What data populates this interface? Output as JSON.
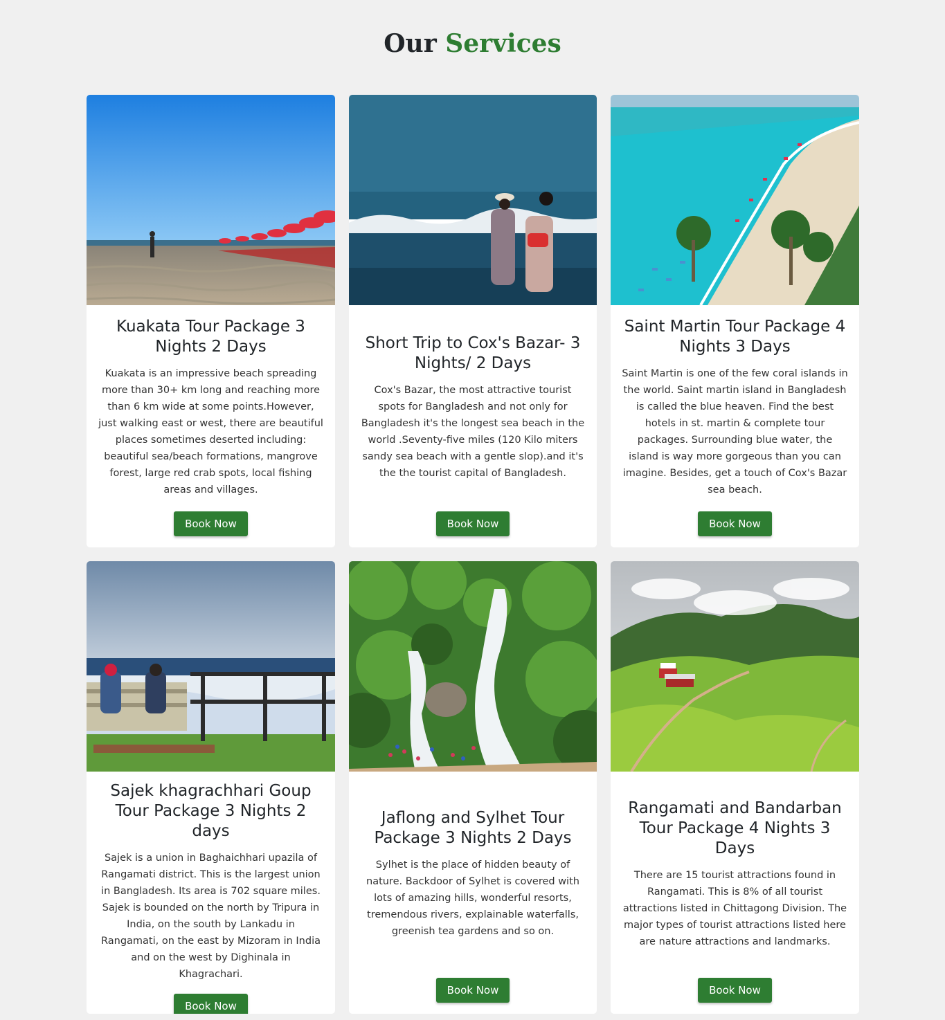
{
  "header": {
    "title_part1": "Our",
    "title_part2": "Services"
  },
  "colors": {
    "accent": "#2e7d32",
    "background": "#f0f0f0"
  },
  "services": [
    {
      "image_alt": "Kuakata beach with red umbrellas",
      "title": "Kuakata Tour Package 3 Nights 2 Days",
      "description": "Kuakata is an impressive beach spreading more than 30+ km long and reaching more than 6 km wide at some points.However, just walking east or west, there are beautiful places sometimes deserted including: beautiful sea/beach formations, mangrove forest, large red crab spots, local fishing areas and villages.",
      "button": "Book Now"
    },
    {
      "image_alt": "Two women at Cox's Bazar sea beach",
      "title": "Short Trip to Cox's Bazar- 3 Nights/ 2 Days",
      "description": "Cox's Bazar, the most attractive tourist spots for Bangladesh and not only for Bangladesh it's the longest sea beach in the world .Seventy-five miles (120 Kilo miters sandy sea beach with a gentle slop).and it's the the tourist capital of Bangladesh.",
      "button": "Book Now"
    },
    {
      "image_alt": "Saint Martin island beach aerial view",
      "title": "Saint Martin Tour Package 4 Nights 3 Days",
      "description": "Saint Martin is one of the few coral islands in the world. Saint martin island in Bangladesh is called the blue heaven. Find the best hotels in st. martin & complete tour packages. Surrounding blue water, the island is way more gorgeous than you can imagine. Besides, get a touch of Cox's Bazar sea beach.",
      "button": "Book Now"
    },
    {
      "image_alt": "Two people on a bench at Sajek valley",
      "title": "Sajek khagrachhari Goup Tour Package 3 Nights 2 days",
      "description": "Sajek is a union in Baghaichhari upazila of Rangamati district. This is the largest union in Bangladesh. Its area is 702 square miles. Sajek is bounded on the north by Tripura in India, on the south by Lankadu in Rangamati, on the east by Mizoram in India and on the west by Dighinala in Khagrachari.",
      "button": "Book Now"
    },
    {
      "image_alt": "Waterfall in Sylhet forest",
      "title": "Jaflong and Sylhet Tour Package 3 Nights 2 Days",
      "description": "Sylhet is the place of hidden beauty of nature. Backdoor of Sylhet is covered with lots of amazing hills, wonderful resorts, tremendous rivers, explainable waterfalls, greenish tea gardens and so on.",
      "button": "Book Now"
    },
    {
      "image_alt": "Green hills of Rangamati and Bandarban",
      "title": "Rangamati and Bandarban Tour Package 4 Nights 3 Days",
      "description": "There are 15 tourist attractions found in Rangamati. This is 8% of all tourist attractions listed in Chittagong Division. The major types of tourist attractions listed here are nature attractions and landmarks.",
      "button": "Book Now"
    }
  ]
}
